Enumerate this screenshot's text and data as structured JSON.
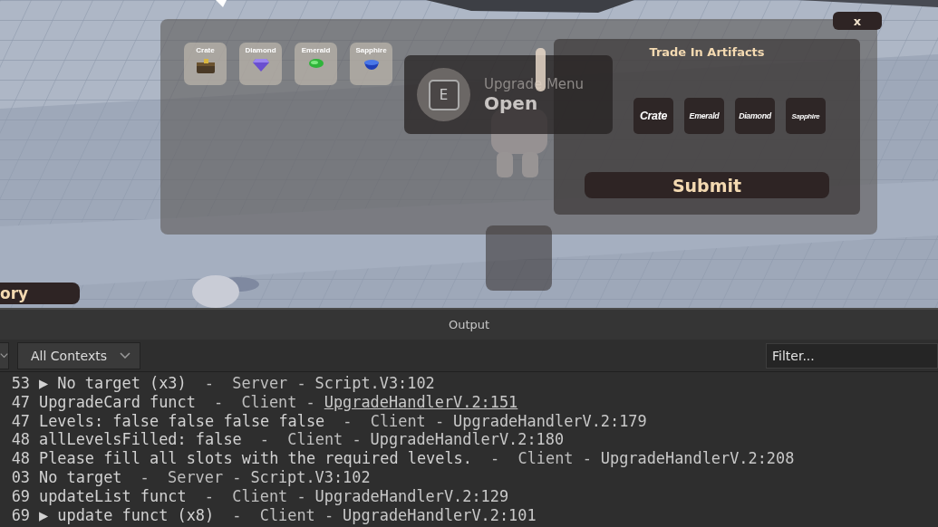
{
  "inventory": [
    {
      "label": "Crate",
      "kind": "crate"
    },
    {
      "label": "Diamond",
      "kind": "diamond"
    },
    {
      "label": "Emerald",
      "kind": "emerald"
    },
    {
      "label": "Sapphire",
      "kind": "sapphire"
    }
  ],
  "prompt": {
    "key": "E",
    "action": "Upgrade Menu",
    "verb": "Open"
  },
  "close_button": "x",
  "trade": {
    "title": "Trade In Artifacts",
    "slots": [
      "Crate",
      "Emerald",
      "Diamond",
      "Sapphire"
    ],
    "submit": "Submit"
  },
  "inventory_button": "ory",
  "output": {
    "title": "Output",
    "context_filter": "All Contexts",
    "filter_placeholder": "Filter...",
    "lines": [
      {
        "time": "53",
        "arrow": "▶",
        "message": "No target (x3)",
        "context": "-  Server -",
        "source": "Script.V3:102",
        "hovered": false
      },
      {
        "time": "47",
        "message": "UpgradeCard funct",
        "context": "-  Client -",
        "source": "UpgradeHandlerV.2:151",
        "hovered": true
      },
      {
        "time": "47",
        "message": "Levels: false false false false",
        "context": "-  Client -",
        "source": "UpgradeHandlerV.2:179",
        "hovered": false
      },
      {
        "time": "48",
        "message": "allLevelsFilled: false",
        "context": "-  Client -",
        "source": "UpgradeHandlerV.2:180",
        "hovered": false
      },
      {
        "time": "48",
        "message": "Please fill all slots with the required levels.",
        "context": "-  Client -",
        "source": "UpgradeHandlerV.2:208",
        "hovered": false
      },
      {
        "time": "03",
        "message": "No target",
        "context": "-  Server -",
        "source": "Script.V3:102",
        "hovered": false
      },
      {
        "time": "69",
        "message": "updateList funct",
        "context": "-  Client -",
        "source": "UpgradeHandlerV.2:129",
        "hovered": false
      },
      {
        "time": "69",
        "arrow": "▶",
        "message": "update funct (x8)",
        "context": "-  Client -",
        "source": "UpgradeHandlerV.2:101",
        "hovered": false
      }
    ]
  }
}
